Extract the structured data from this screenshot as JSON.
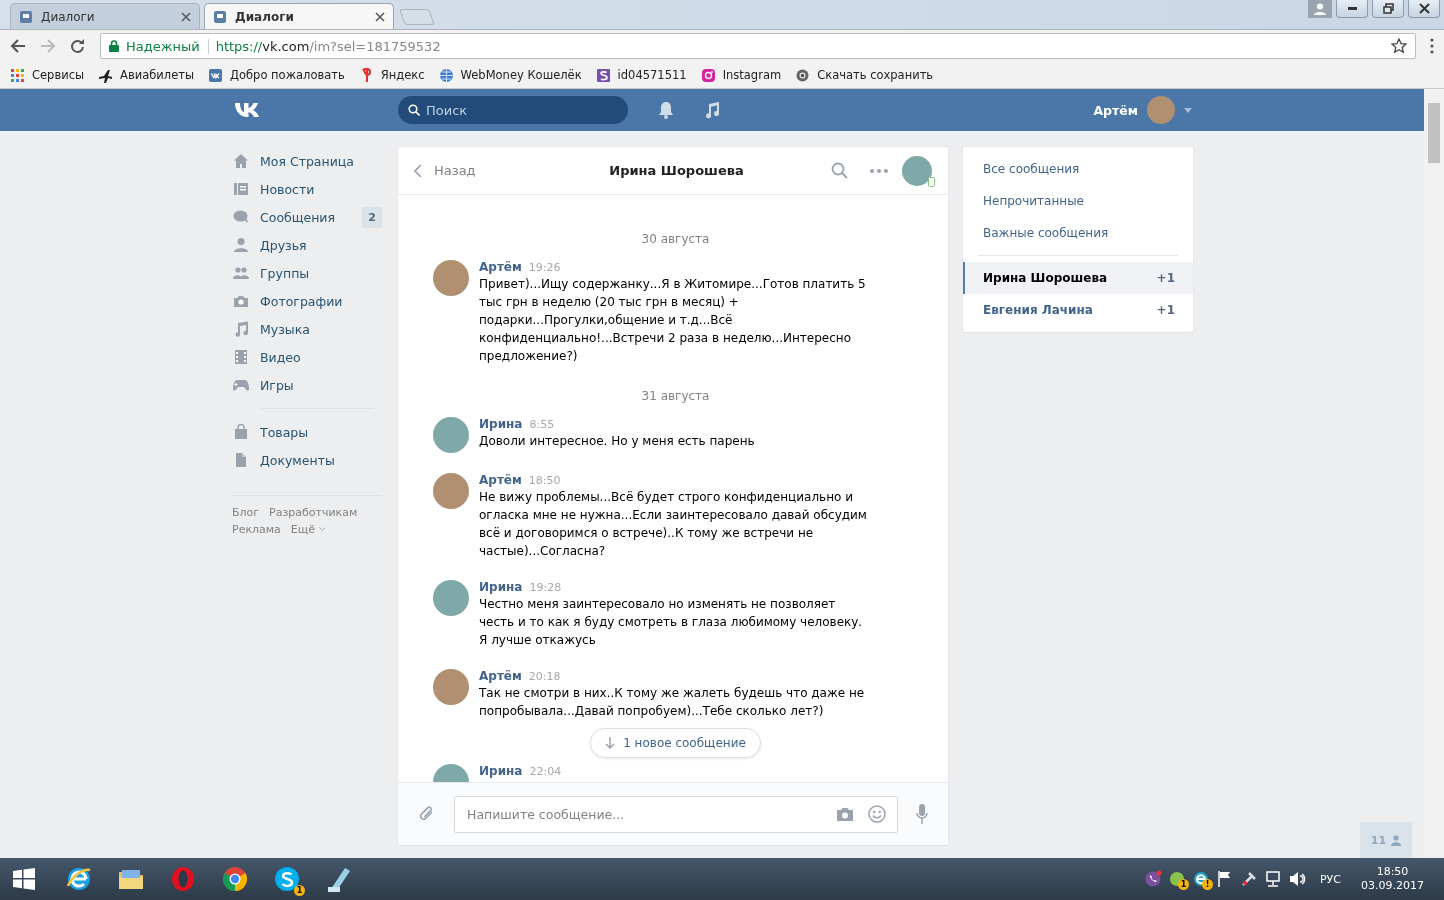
{
  "browser": {
    "tabs": [
      {
        "title": "Диалоги",
        "selected": false
      },
      {
        "title": "Диалоги",
        "selected": true
      }
    ],
    "address": {
      "security": "Надежный",
      "url": [
        "https://",
        "vk.com",
        "/im?sel=181759532"
      ]
    },
    "bookmarks": [
      {
        "kind": "apps",
        "label": "Сервисы"
      },
      {
        "kind": "plane",
        "label": "Авиабилеты"
      },
      {
        "kind": "vk",
        "label": "Добро пожаловать"
      },
      {
        "kind": "yandex",
        "label": "Яндекс"
      },
      {
        "kind": "globe",
        "label": "WebMoney Кошелёк"
      },
      {
        "kind": "s",
        "label": "id04571511"
      },
      {
        "kind": "instagram",
        "label": "Instagram"
      },
      {
        "kind": "eye",
        "label": "Скачать сохранить"
      }
    ]
  },
  "header": {
    "search_placeholder": "Поиск",
    "user": "Артём"
  },
  "nav": {
    "items": [
      {
        "kind": "home",
        "label": "Моя Страница"
      },
      {
        "kind": "news",
        "label": "Новости"
      },
      {
        "kind": "chat",
        "label": "Сообщения",
        "badge": "2"
      },
      {
        "kind": "person",
        "label": "Друзья"
      },
      {
        "kind": "people",
        "label": "Группы"
      },
      {
        "kind": "camera",
        "label": "Фотографии"
      },
      {
        "kind": "note",
        "label": "Музыка"
      },
      {
        "kind": "film",
        "label": "Видео"
      },
      {
        "kind": "gamepad",
        "label": "Игры"
      },
      {
        "kind": "divider"
      },
      {
        "kind": "bag",
        "label": "Товары"
      },
      {
        "kind": "doc",
        "label": "Документы"
      }
    ],
    "footer": [
      "Блог",
      "Разработчикам",
      "Реклама",
      "Ещё"
    ]
  },
  "chat": {
    "back": "Назад",
    "title": "Ирина Шорошева",
    "messages": [
      {
        "kind": "date",
        "text": "30 августа"
      },
      {
        "kind": "outgoing",
        "author": "Артём",
        "time": "19:26",
        "text": "Привет)...Ищу содержанку...Я в Житомире...Готов платить 5 тыс грн в неделю (20 тыс грн в месяц) + подарки...Прогулки,общение и т.д...Всё конфиденциально!...Встречи 2 раза в неделю...Интересно предложение?)"
      },
      {
        "kind": "date",
        "text": "31 августа"
      },
      {
        "kind": "incoming",
        "author": "Ирина",
        "time": "8:55",
        "text": "Доволи интересное. Но у меня есть парень"
      },
      {
        "kind": "outgoing",
        "author": "Артём",
        "time": "18:50",
        "text": "Не вижу проблемы...Всё будет строго конфиденциально и огласка мне не нужна...Если заинтересовало давай обсудим всё и договоримся о встрече)..К тому же встречи не частые)...Согласна?"
      },
      {
        "kind": "incoming",
        "author": "Ирина",
        "time": "19:28",
        "text": "Честно меня заинтересовало но изменять не позволяет честь и то как я буду смотреть в глаза любимому человеку. Я лучше откажусь"
      },
      {
        "kind": "outgoing",
        "author": "Артём",
        "time": "20:18",
        "text": "Так не смотри в них..К тому же жалеть будешь что даже не попробывала...Давай попробуем)...Тебе сколько лет?)"
      },
      {
        "kind": "new",
        "text": "1 новое сообщение"
      },
      {
        "kind": "incoming",
        "author": "Ирина",
        "time": "22:04"
      }
    ],
    "compose_placeholder": "Напишите сообщение..."
  },
  "filters": {
    "items": [
      {
        "label": "Все сообщения"
      },
      {
        "label": "Непрочитанные"
      },
      {
        "label": "Важные сообщения"
      }
    ],
    "dialogs": [
      {
        "name": "Ирина Шорошева",
        "count": "+1",
        "selected": true
      },
      {
        "name": "Евгения Лачина",
        "count": "+1",
        "selected": false
      }
    ]
  },
  "online_friends": "11",
  "taskbar": {
    "apps": [
      {
        "kind": "ie"
      },
      {
        "kind": "folder"
      },
      {
        "kind": "opera"
      },
      {
        "kind": "chrome"
      },
      {
        "kind": "skype",
        "badge": "1"
      },
      {
        "kind": "notepad"
      }
    ],
    "tray": [
      {
        "kind": "viber"
      },
      {
        "kind": "coin",
        "badge": "1"
      },
      {
        "kind": "e",
        "badge": "!"
      },
      {
        "kind": "flag"
      },
      {
        "kind": "tool"
      },
      {
        "kind": "network"
      },
      {
        "kind": "speaker"
      }
    ],
    "language": "РУС",
    "time": "18:50",
    "date": "03.09.2017"
  }
}
